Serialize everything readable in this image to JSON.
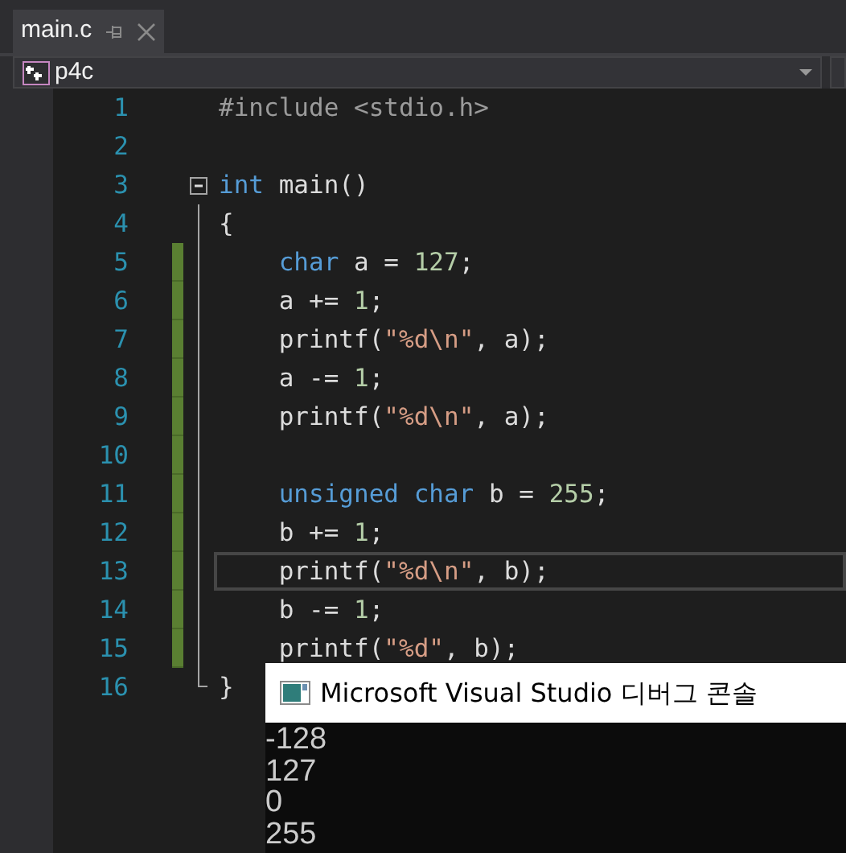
{
  "tab": {
    "title": "main.c",
    "selected": true
  },
  "nav": {
    "scope": "p4c"
  },
  "editor": {
    "lines": [
      {
        "number": "1",
        "changed": false,
        "current": false,
        "tokens": [
          {
            "text": "#include <stdio.h>",
            "kind": "preprocessor"
          }
        ]
      },
      {
        "number": "2",
        "changed": false,
        "current": false
      },
      {
        "number": "3",
        "changed": false,
        "current": false,
        "fold": {
          "expanded": true
        },
        "tokens": [
          {
            "text": "int",
            "kind": "keyword"
          },
          {
            "text": " main()",
            "kind": "plain"
          }
        ]
      },
      {
        "number": "4",
        "changed": false,
        "current": false,
        "tokens": [
          {
            "text": "{",
            "kind": "plain"
          }
        ]
      },
      {
        "number": "5",
        "changed": true,
        "current": false,
        "tokens": [
          {
            "text": "    char",
            "kind": "keyword"
          },
          {
            "text": " a = ",
            "kind": "plain"
          },
          {
            "text": "127",
            "kind": "number"
          },
          {
            "text": ";",
            "kind": "plain"
          }
        ]
      },
      {
        "number": "6",
        "changed": true,
        "current": false,
        "tokens": [
          {
            "text": "    a += ",
            "kind": "plain"
          },
          {
            "text": "1",
            "kind": "number"
          },
          {
            "text": ";",
            "kind": "plain"
          }
        ]
      },
      {
        "number": "7",
        "changed": true,
        "current": false,
        "tokens": [
          {
            "text": "    printf(",
            "kind": "plain"
          },
          {
            "text": "\"%d\\n\"",
            "kind": "string"
          },
          {
            "text": ", a);",
            "kind": "plain"
          }
        ]
      },
      {
        "number": "8",
        "changed": true,
        "current": false,
        "tokens": [
          {
            "text": "    a -= ",
            "kind": "plain"
          },
          {
            "text": "1",
            "kind": "number"
          },
          {
            "text": ";",
            "kind": "plain"
          }
        ]
      },
      {
        "number": "9",
        "changed": true,
        "current": false,
        "tokens": [
          {
            "text": "    printf(",
            "kind": "plain"
          },
          {
            "text": "\"%d\\n\"",
            "kind": "string"
          },
          {
            "text": ", a);",
            "kind": "plain"
          }
        ]
      },
      {
        "number": "10",
        "changed": true,
        "current": false
      },
      {
        "number": "11",
        "changed": true,
        "current": false,
        "tokens": [
          {
            "text": "    unsigned char",
            "kind": "keyword"
          },
          {
            "text": " b = ",
            "kind": "plain"
          },
          {
            "text": "255",
            "kind": "number"
          },
          {
            "text": ";",
            "kind": "plain"
          }
        ]
      },
      {
        "number": "12",
        "changed": true,
        "current": false,
        "tokens": [
          {
            "text": "    b += ",
            "kind": "plain"
          },
          {
            "text": "1",
            "kind": "number"
          },
          {
            "text": ";",
            "kind": "plain"
          }
        ]
      },
      {
        "number": "13",
        "changed": true,
        "current": true,
        "tokens": [
          {
            "text": "    printf(",
            "kind": "plain"
          },
          {
            "text": "\"%d\\n\"",
            "kind": "string"
          },
          {
            "text": ", b);",
            "kind": "plain"
          }
        ]
      },
      {
        "number": "14",
        "changed": true,
        "current": false,
        "tokens": [
          {
            "text": "    b -= ",
            "kind": "plain"
          },
          {
            "text": "1",
            "kind": "number"
          },
          {
            "text": ";",
            "kind": "plain"
          }
        ]
      },
      {
        "number": "15",
        "changed": true,
        "current": false,
        "tokens": [
          {
            "text": "    printf(",
            "kind": "plain"
          },
          {
            "text": "\"%d\"",
            "kind": "string"
          },
          {
            "text": ", b);",
            "kind": "plain"
          }
        ]
      },
      {
        "number": "16",
        "changed": false,
        "current": false,
        "tokens": [
          {
            "text": "}",
            "kind": "plain"
          }
        ]
      }
    ]
  },
  "console": {
    "title": "Microsoft Visual Studio 디버그 콘솔",
    "output": [
      "-128",
      "127",
      "0",
      "255"
    ]
  }
}
